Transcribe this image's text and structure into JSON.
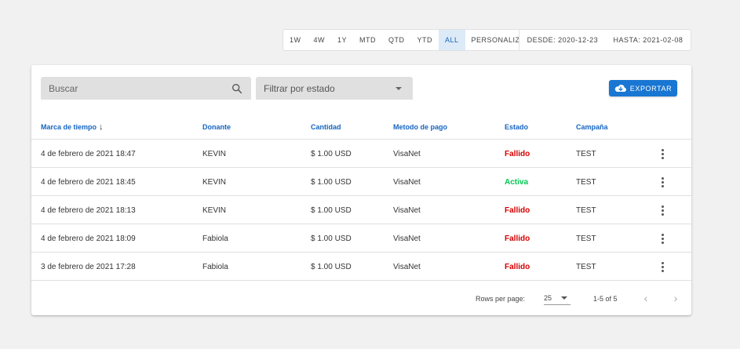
{
  "range_buttons": [
    {
      "label": "1W",
      "active": false
    },
    {
      "label": "4W",
      "active": false
    },
    {
      "label": "1Y",
      "active": false
    },
    {
      "label": "MTD",
      "active": false
    },
    {
      "label": "QTD",
      "active": false
    },
    {
      "label": "YTD",
      "active": false
    },
    {
      "label": "ALL",
      "active": true
    },
    {
      "label": "PERSONALIZADO",
      "active": false
    }
  ],
  "dates": {
    "from": "DESDE: 2020-12-23",
    "to": "HASTA: 2021-02-08"
  },
  "search": {
    "placeholder": "Buscar",
    "icon": "search-icon"
  },
  "filter": {
    "label": "Filtrar por estado"
  },
  "export": {
    "label": "EXPORTAR",
    "icon": "cloud-download-icon"
  },
  "table": {
    "headers": [
      "Marca de tiempo",
      "Donante",
      "Cantidad",
      "Metodo de pago",
      "Estado",
      "Campaña"
    ],
    "rows": [
      {
        "timestamp": "4 de febrero de 2021 18:47",
        "donor": "KEVIN",
        "amount": "$ 1.00 USD",
        "method": "VisaNet",
        "status": "Fallido",
        "campaign": "TEST"
      },
      {
        "timestamp": "4 de febrero de 2021 18:45",
        "donor": "KEVIN",
        "amount": "$ 1.00 USD",
        "method": "VisaNet",
        "status": "Activa",
        "campaign": "TEST"
      },
      {
        "timestamp": "4 de febrero de 2021 18:13",
        "donor": "KEVIN",
        "amount": "$ 1.00 USD",
        "method": "VisaNet",
        "status": "Fallido",
        "campaign": "TEST"
      },
      {
        "timestamp": "4 de febrero de 2021 18:09",
        "donor": "Fabiola",
        "amount": "$ 1.00 USD",
        "method": "VisaNet",
        "status": "Fallido",
        "campaign": "TEST"
      },
      {
        "timestamp": "3 de febrero de 2021 17:28",
        "donor": "Fabiola",
        "amount": "$ 1.00 USD",
        "method": "VisaNet",
        "status": "Fallido",
        "campaign": "TEST"
      }
    ]
  },
  "footer": {
    "rows_per_page_label": "Rows per page:",
    "rows_per_page": "25",
    "range": "1-5 of 5"
  },
  "colors": {
    "accent": "#1976d2",
    "fail": "#d50000",
    "active": "#00c853"
  }
}
